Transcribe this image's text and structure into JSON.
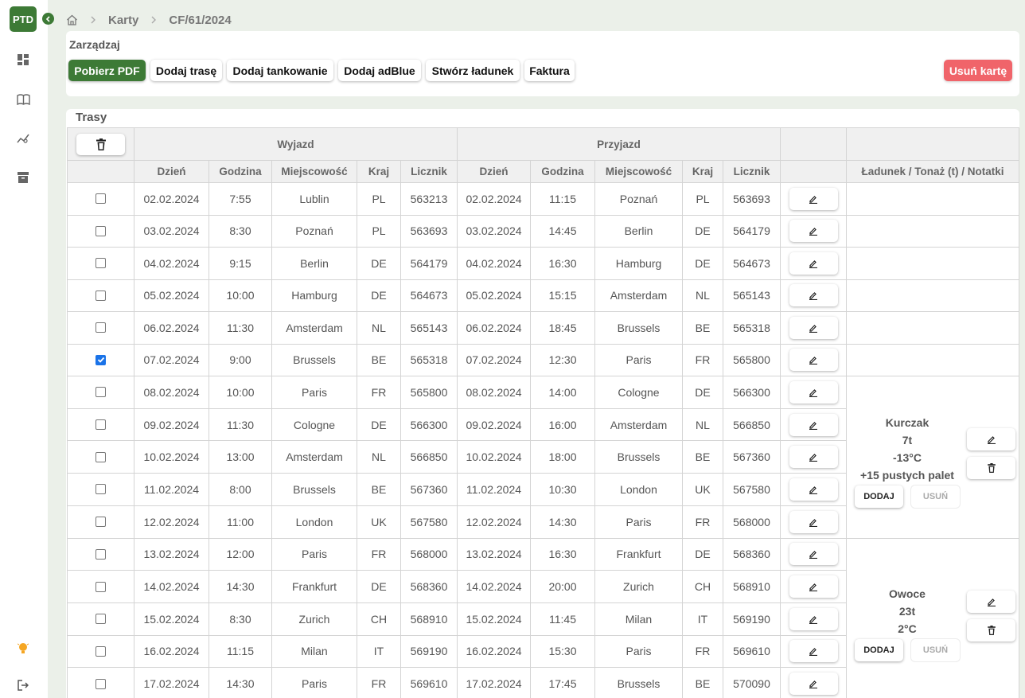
{
  "app": {
    "logo": "PTD"
  },
  "sidebar": {
    "items": [
      {
        "icon": "dashboard-icon"
      },
      {
        "icon": "book-icon"
      },
      {
        "icon": "chart-icon"
      },
      {
        "icon": "archive-icon"
      },
      {
        "icon": "lightbulb-icon"
      },
      {
        "icon": "logout-icon"
      }
    ]
  },
  "breadcrumb": {
    "home_icon": "home-icon",
    "items": [
      "Karty",
      "CF/61/2024"
    ]
  },
  "manage": {
    "title": "Zarządzaj",
    "buttons": {
      "pdf": "Pobierz PDF",
      "add_route": "Dodaj trasę",
      "add_fuel": "Dodaj tankowanie",
      "add_adblue": "Dodaj adBlue",
      "create_cargo": "Stwórz ładunek",
      "invoice": "Faktura",
      "delete_card": "Usuń kartę"
    }
  },
  "routes": {
    "title": "Trasy",
    "group_headers": {
      "departure": "Wyjazd",
      "arrival": "Przyjazd"
    },
    "columns": [
      "Dzień",
      "Godzina",
      "Miejscowość",
      "Kraj",
      "Licznik",
      "Dzień",
      "Godzina",
      "Miejscowość",
      "Kraj",
      "Licznik"
    ],
    "cargo_header": "Ładunek / Tonaż (t) / Notatki",
    "rows": [
      {
        "checked": false,
        "d_date": "02.02.2024",
        "d_time": "7:55",
        "d_city": "Lublin",
        "d_country": "PL",
        "d_meter": "563213",
        "a_date": "02.02.2024",
        "a_time": "11:15",
        "a_city": "Poznań",
        "a_country": "PL",
        "a_meter": "563693"
      },
      {
        "checked": false,
        "d_date": "03.02.2024",
        "d_time": "8:30",
        "d_city": "Poznań",
        "d_country": "PL",
        "d_meter": "563693",
        "a_date": "03.02.2024",
        "a_time": "14:45",
        "a_city": "Berlin",
        "a_country": "DE",
        "a_meter": "564179"
      },
      {
        "checked": false,
        "d_date": "04.02.2024",
        "d_time": "9:15",
        "d_city": "Berlin",
        "d_country": "DE",
        "d_meter": "564179",
        "a_date": "04.02.2024",
        "a_time": "16:30",
        "a_city": "Hamburg",
        "a_country": "DE",
        "a_meter": "564673"
      },
      {
        "checked": false,
        "d_date": "05.02.2024",
        "d_time": "10:00",
        "d_city": "Hamburg",
        "d_country": "DE",
        "d_meter": "564673",
        "a_date": "05.02.2024",
        "a_time": "15:15",
        "a_city": "Amsterdam",
        "a_country": "NL",
        "a_meter": "565143"
      },
      {
        "checked": false,
        "d_date": "06.02.2024",
        "d_time": "11:30",
        "d_city": "Amsterdam",
        "d_country": "NL",
        "d_meter": "565143",
        "a_date": "06.02.2024",
        "a_time": "18:45",
        "a_city": "Brussels",
        "a_country": "BE",
        "a_meter": "565318"
      },
      {
        "checked": true,
        "d_date": "07.02.2024",
        "d_time": "9:00",
        "d_city": "Brussels",
        "d_country": "BE",
        "d_meter": "565318",
        "a_date": "07.02.2024",
        "a_time": "12:30",
        "a_city": "Paris",
        "a_country": "FR",
        "a_meter": "565800"
      },
      {
        "checked": false,
        "d_date": "08.02.2024",
        "d_time": "10:00",
        "d_city": "Paris",
        "d_country": "FR",
        "d_meter": "565800",
        "a_date": "08.02.2024",
        "a_time": "14:00",
        "a_city": "Cologne",
        "a_country": "DE",
        "a_meter": "566300"
      },
      {
        "checked": false,
        "d_date": "09.02.2024",
        "d_time": "11:30",
        "d_city": "Cologne",
        "d_country": "DE",
        "d_meter": "566300",
        "a_date": "09.02.2024",
        "a_time": "16:00",
        "a_city": "Amsterdam",
        "a_country": "NL",
        "a_meter": "566850"
      },
      {
        "checked": false,
        "d_date": "10.02.2024",
        "d_time": "13:00",
        "d_city": "Amsterdam",
        "d_country": "NL",
        "d_meter": "566850",
        "a_date": "10.02.2024",
        "a_time": "18:00",
        "a_city": "Brussels",
        "a_country": "BE",
        "a_meter": "567360"
      },
      {
        "checked": false,
        "d_date": "11.02.2024",
        "d_time": "8:00",
        "d_city": "Brussels",
        "d_country": "BE",
        "d_meter": "567360",
        "a_date": "11.02.2024",
        "a_time": "10:30",
        "a_city": "London",
        "a_country": "UK",
        "a_meter": "567580"
      },
      {
        "checked": false,
        "d_date": "12.02.2024",
        "d_time": "11:00",
        "d_city": "London",
        "d_country": "UK",
        "d_meter": "567580",
        "a_date": "12.02.2024",
        "a_time": "14:30",
        "a_city": "Paris",
        "a_country": "FR",
        "a_meter": "568000"
      },
      {
        "checked": false,
        "d_date": "13.02.2024",
        "d_time": "12:00",
        "d_city": "Paris",
        "d_country": "FR",
        "d_meter": "568000",
        "a_date": "13.02.2024",
        "a_time": "16:30",
        "a_city": "Frankfurt",
        "a_country": "DE",
        "a_meter": "568360"
      },
      {
        "checked": false,
        "d_date": "14.02.2024",
        "d_time": "14:30",
        "d_city": "Frankfurt",
        "d_country": "DE",
        "d_meter": "568360",
        "a_date": "14.02.2024",
        "a_time": "20:00",
        "a_city": "Zurich",
        "a_country": "CH",
        "a_meter": "568910"
      },
      {
        "checked": false,
        "d_date": "15.02.2024",
        "d_time": "8:30",
        "d_city": "Zurich",
        "d_country": "CH",
        "d_meter": "568910",
        "a_date": "15.02.2024",
        "a_time": "11:45",
        "a_city": "Milan",
        "a_country": "IT",
        "a_meter": "569190"
      },
      {
        "checked": false,
        "d_date": "16.02.2024",
        "d_time": "11:15",
        "d_city": "Milan",
        "d_country": "IT",
        "d_meter": "569190",
        "a_date": "16.02.2024",
        "a_time": "15:30",
        "a_city": "Paris",
        "a_country": "FR",
        "a_meter": "569610"
      },
      {
        "checked": false,
        "d_date": "17.02.2024",
        "d_time": "14:30",
        "d_city": "Paris",
        "d_country": "FR",
        "d_meter": "569610",
        "a_date": "17.02.2024",
        "a_time": "17:45",
        "a_city": "Brussels",
        "a_country": "BE",
        "a_meter": "570090"
      }
    ],
    "cargos": [
      {
        "rows": 5,
        "name": "Kurczak",
        "tonnage": "7t",
        "temp": "-13°C",
        "note": "+15 pustych palet",
        "add_label": "DODAJ",
        "remove_label": "USUŃ"
      },
      {
        "rows": 5,
        "name": "Owoce",
        "tonnage": "23t",
        "temp": "2°C",
        "note": "",
        "add_label": "DODAJ",
        "remove_label": "USUŃ"
      }
    ]
  }
}
